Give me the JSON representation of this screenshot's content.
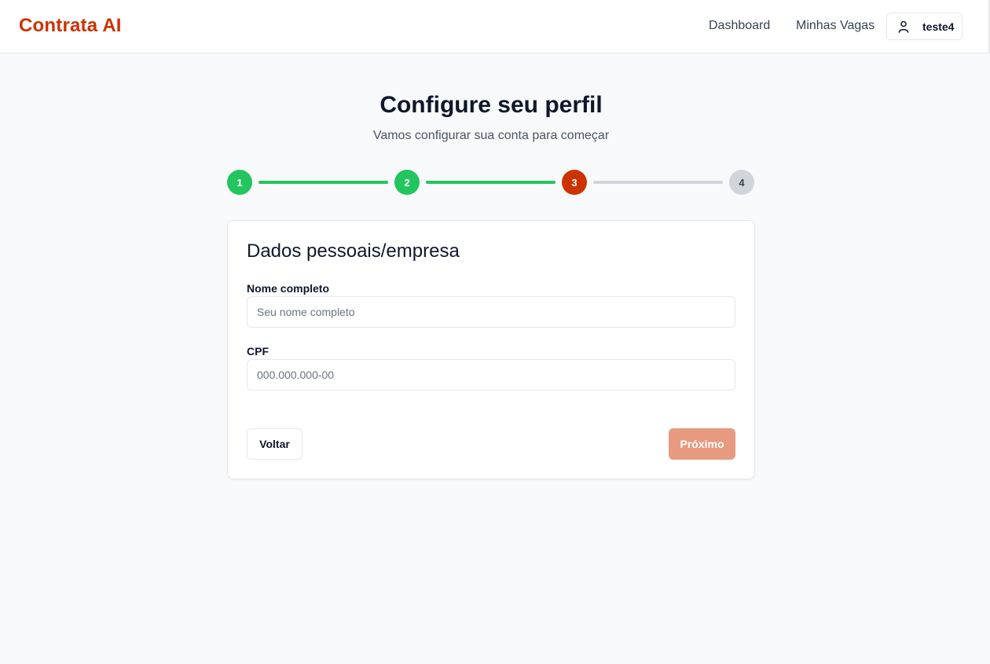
{
  "header": {
    "brand": "Contrata AI",
    "nav": {
      "dashboard": "Dashboard",
      "vagas": "Minhas Vagas"
    },
    "user": {
      "name": "teste4",
      "icon": "user-icon"
    }
  },
  "page": {
    "title": "Configure seu perfil",
    "subtitle": "Vamos configurar sua conta para começar"
  },
  "stepper": {
    "current": 3,
    "steps": [
      {
        "label": "1",
        "status": "completed"
      },
      {
        "label": "2",
        "status": "completed"
      },
      {
        "label": "3",
        "status": "current"
      },
      {
        "label": "4",
        "status": "pending"
      }
    ]
  },
  "form": {
    "title": "Dados pessoais/empresa",
    "fields": {
      "nome": {
        "label": "Nome completo",
        "value": "",
        "placeholder": "Seu nome completo"
      },
      "cpf": {
        "label": "CPF",
        "value": "",
        "placeholder": "000.000.000-00"
      }
    },
    "buttons": {
      "back": "Voltar",
      "next": "Próximo",
      "next_disabled": true
    }
  },
  "colors": {
    "brand": "#cc3300",
    "step_completed": "#22c55e",
    "step_current": "#cc3300",
    "step_pending": "#d1d5db",
    "next_disabled": "#e89a80"
  }
}
